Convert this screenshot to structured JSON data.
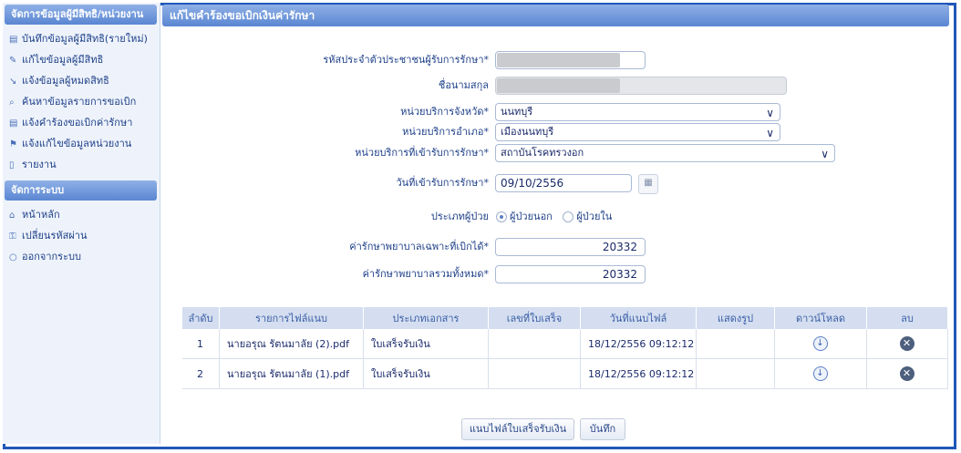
{
  "sidebar": {
    "section1_title": "จัดการข้อมูลผู้มีสิทธิ/หน่วยงาน",
    "items1": [
      {
        "icon": "▤",
        "label": "บันทึกข้อมูลผู้มีสิทธิ(รายใหม่)"
      },
      {
        "icon": "✎",
        "label": "แก้ไขข้อมูลผู้มีสิทธิ"
      },
      {
        "icon": "↘",
        "label": "แจ้งข้อมูลผู้หมดสิทธิ"
      },
      {
        "icon": "⌕",
        "label": "ค้นหาข้อมูลรายการขอเบิก"
      },
      {
        "icon": "▤",
        "label": "แจ้งคำร้องขอเบิกค่ารักษา"
      },
      {
        "icon": "⚑",
        "label": "แจ้งแก้ไขข้อมูลหน่วยงาน"
      },
      {
        "icon": "▯",
        "label": "รายงาน"
      }
    ],
    "section2_title": "จัดการระบบ",
    "items2": [
      {
        "icon": "⌂",
        "label": "หน้าหลัก"
      },
      {
        "icon": "⚿",
        "label": "เปลี่ยนรหัสผ่าน"
      },
      {
        "icon": "○",
        "label": "ออกจากระบบ"
      }
    ]
  },
  "main": {
    "title": "แก้ไขคำร้องขอเบิกเงินค่ารักษา",
    "form": {
      "id_label": "รหัสประจำตัวประชาชนผู้รับการรักษา*",
      "name_label": "ชื่อนามสกุล",
      "province_label": "หน่วยบริการจังหวัด*",
      "province_value": "นนทบุรี",
      "district_label": "หน่วยบริการอำเภอ*",
      "district_value": "เมืองนนทบุรี",
      "hospital_label": "หน่วยบริการที่เข้ารับการรักษา*",
      "hospital_value": "สถาบันโรคทรวงอก",
      "date_label": "วันที่เข้ารับการรักษา*",
      "date_value": "09/10/2556",
      "patient_type_label": "ประเภทผู้ป่วย",
      "patient_type_options": [
        "ผู้ป่วยนอก",
        "ผู้ป่วยใน"
      ],
      "patient_type_selected": "ผู้ป่วยนอก",
      "claimable_label": "ค่ารักษาพยาบาลเฉพาะที่เบิกได้*",
      "claimable_value": "20332",
      "total_label": "ค่ารักษาพยาบาลรวมทั้งหมด*",
      "total_value": "20332"
    },
    "table": {
      "headers": [
        "ลำดับ",
        "รายการไฟล์แนบ",
        "ประเภทเอกสาร",
        "เลขที่ใบเสร็จ",
        "วันที่แนบไฟล์",
        "แสดงรูป",
        "ดาวน์โหลด",
        "ลบ"
      ],
      "rows": [
        {
          "no": "1",
          "file": "นายอรุณ รัตนมาลัย (2).pdf",
          "doc_type": "ใบเสร็จรับเงิน",
          "receipt_no": "",
          "date": "18/12/2556 09:12:12"
        },
        {
          "no": "2",
          "file": "นายอรุณ รัตนมาลัย (1).pdf",
          "doc_type": "ใบเสร็จรับเงิน",
          "receipt_no": "",
          "date": "18/12/2556 09:12:12"
        }
      ]
    },
    "buttons": {
      "attach": "แนบไฟล์ใบเสร็จรับเงิน",
      "save": "บันทึก"
    }
  },
  "colors": {
    "frame": "#1f57b8",
    "header_gradient_top": "#8fb0e6",
    "header_gradient_bottom": "#5a86d2",
    "table_header_bg": "#d4def0"
  }
}
